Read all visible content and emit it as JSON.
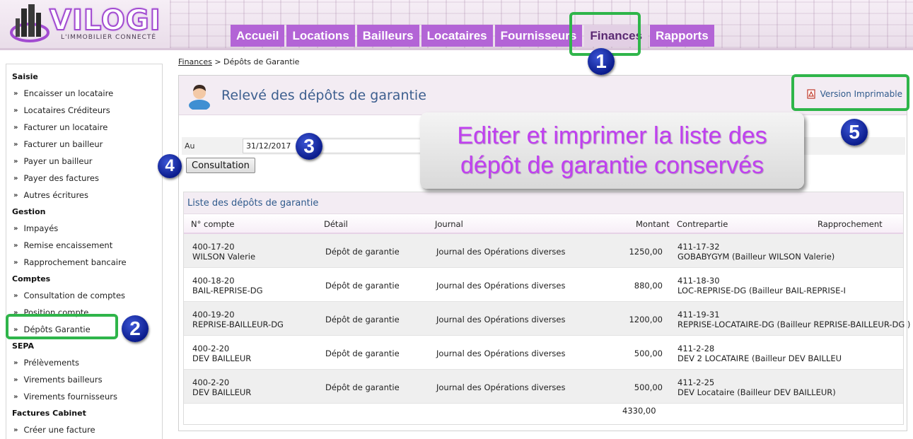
{
  "brand": {
    "name": "VILOGI",
    "tagline": "L'IMMOBILIER CONNECTÉ",
    "accent": "#b364d6"
  },
  "nav": {
    "tabs": [
      {
        "label": "Accueil"
      },
      {
        "label": "Locations"
      },
      {
        "label": "Bailleurs"
      },
      {
        "label": "Locataires"
      },
      {
        "label": "Fournisseurs"
      },
      {
        "label": "Finances",
        "active": true
      },
      {
        "label": "Rapports"
      }
    ]
  },
  "sidebar": {
    "sections": [
      {
        "title": "Saisie",
        "items": [
          "Encaisser un locataire",
          "Locataires Créditeurs",
          "Facturer un locataire",
          "Facturer un bailleur",
          "Payer un bailleur",
          "Payer des factures",
          "Autres écritures"
        ]
      },
      {
        "title": "Gestion",
        "items": [
          "Impayés",
          "Remise encaissement",
          "Rapprochement bancaire"
        ]
      },
      {
        "title": "Comptes",
        "items": [
          "Consultation de comptes",
          "Position compte",
          "Dépôts Garantie"
        ]
      },
      {
        "title": "SEPA",
        "items": [
          "Prélèvements",
          "Virements bailleurs",
          "Virements fournisseurs"
        ]
      },
      {
        "title": "Factures Cabinet",
        "items": [
          "Créer une facture"
        ]
      }
    ],
    "chevron": "»"
  },
  "breadcrumb": {
    "parent": "Finances",
    "separator": ">",
    "current": "Dépôts de Garantie"
  },
  "panel": {
    "title": "Relevé des dépôts de garantie",
    "print_label": "Version Imprimable",
    "form": {
      "label": "Au",
      "date_value": "31/12/2017"
    },
    "submit_label": "Consultation"
  },
  "list": {
    "title": "Liste des dépôts de garantie",
    "columns": [
      "N° compte",
      "Détail",
      "Journal",
      "Montant",
      "Contrepartie",
      "Rapprochement"
    ],
    "rows": [
      {
        "compte": "400-17-20",
        "nom": "WILSON Valerie",
        "detail": "Dépôt de garantie",
        "journal": "Journal des Opérations diverses",
        "montant": "1250,00",
        "cp_compte": "411-17-32",
        "cp_nom": "GOBABYGYM (Bailleur WILSON Valerie)"
      },
      {
        "compte": "400-18-20",
        "nom": "BAIL-REPRISE-DG",
        "detail": "Dépôt de garantie",
        "journal": "Journal des Opérations diverses",
        "montant": "880,00",
        "cp_compte": "411-18-30",
        "cp_nom": "LOC-REPRISE-DG (Bailleur BAIL-REPRISE-I"
      },
      {
        "compte": "400-19-20",
        "nom": "REPRISE-BAILLEUR-DG",
        "detail": "Dépôt de garantie",
        "journal": "Journal des Opérations diverses",
        "montant": "1200,00",
        "cp_compte": "411-19-31",
        "cp_nom": "REPRISE-LOCATAIRE-DG (Bailleur REPRISE-BAILLEUR-DG )"
      },
      {
        "compte": "400-2-20",
        "nom": "DEV BAILLEUR",
        "detail": "Dépôt de garantie",
        "journal": "Journal des Opérations diverses",
        "montant": "500,00",
        "cp_compte": "411-2-28",
        "cp_nom": "DEV 2 LOCATAIRE (Bailleur DEV BAILLEU"
      },
      {
        "compte": "400-2-20",
        "nom": "DEV BAILLEUR",
        "detail": "Dépôt de garantie",
        "journal": "Journal des Opérations diverses",
        "montant": "500,00",
        "cp_compte": "411-2-25",
        "cp_nom": "DEV Locataire (Bailleur DEV BAILLEUR)"
      }
    ],
    "total": "4330,00"
  },
  "annotations": {
    "callouts": [
      "1",
      "2",
      "3",
      "4",
      "5"
    ],
    "overlay_line1": "Editer et imprimer la liste des",
    "overlay_line2": "dépôt de garantie conservés",
    "highlight_color": "#2fb54a",
    "callout_color": "#0b1c8c"
  }
}
